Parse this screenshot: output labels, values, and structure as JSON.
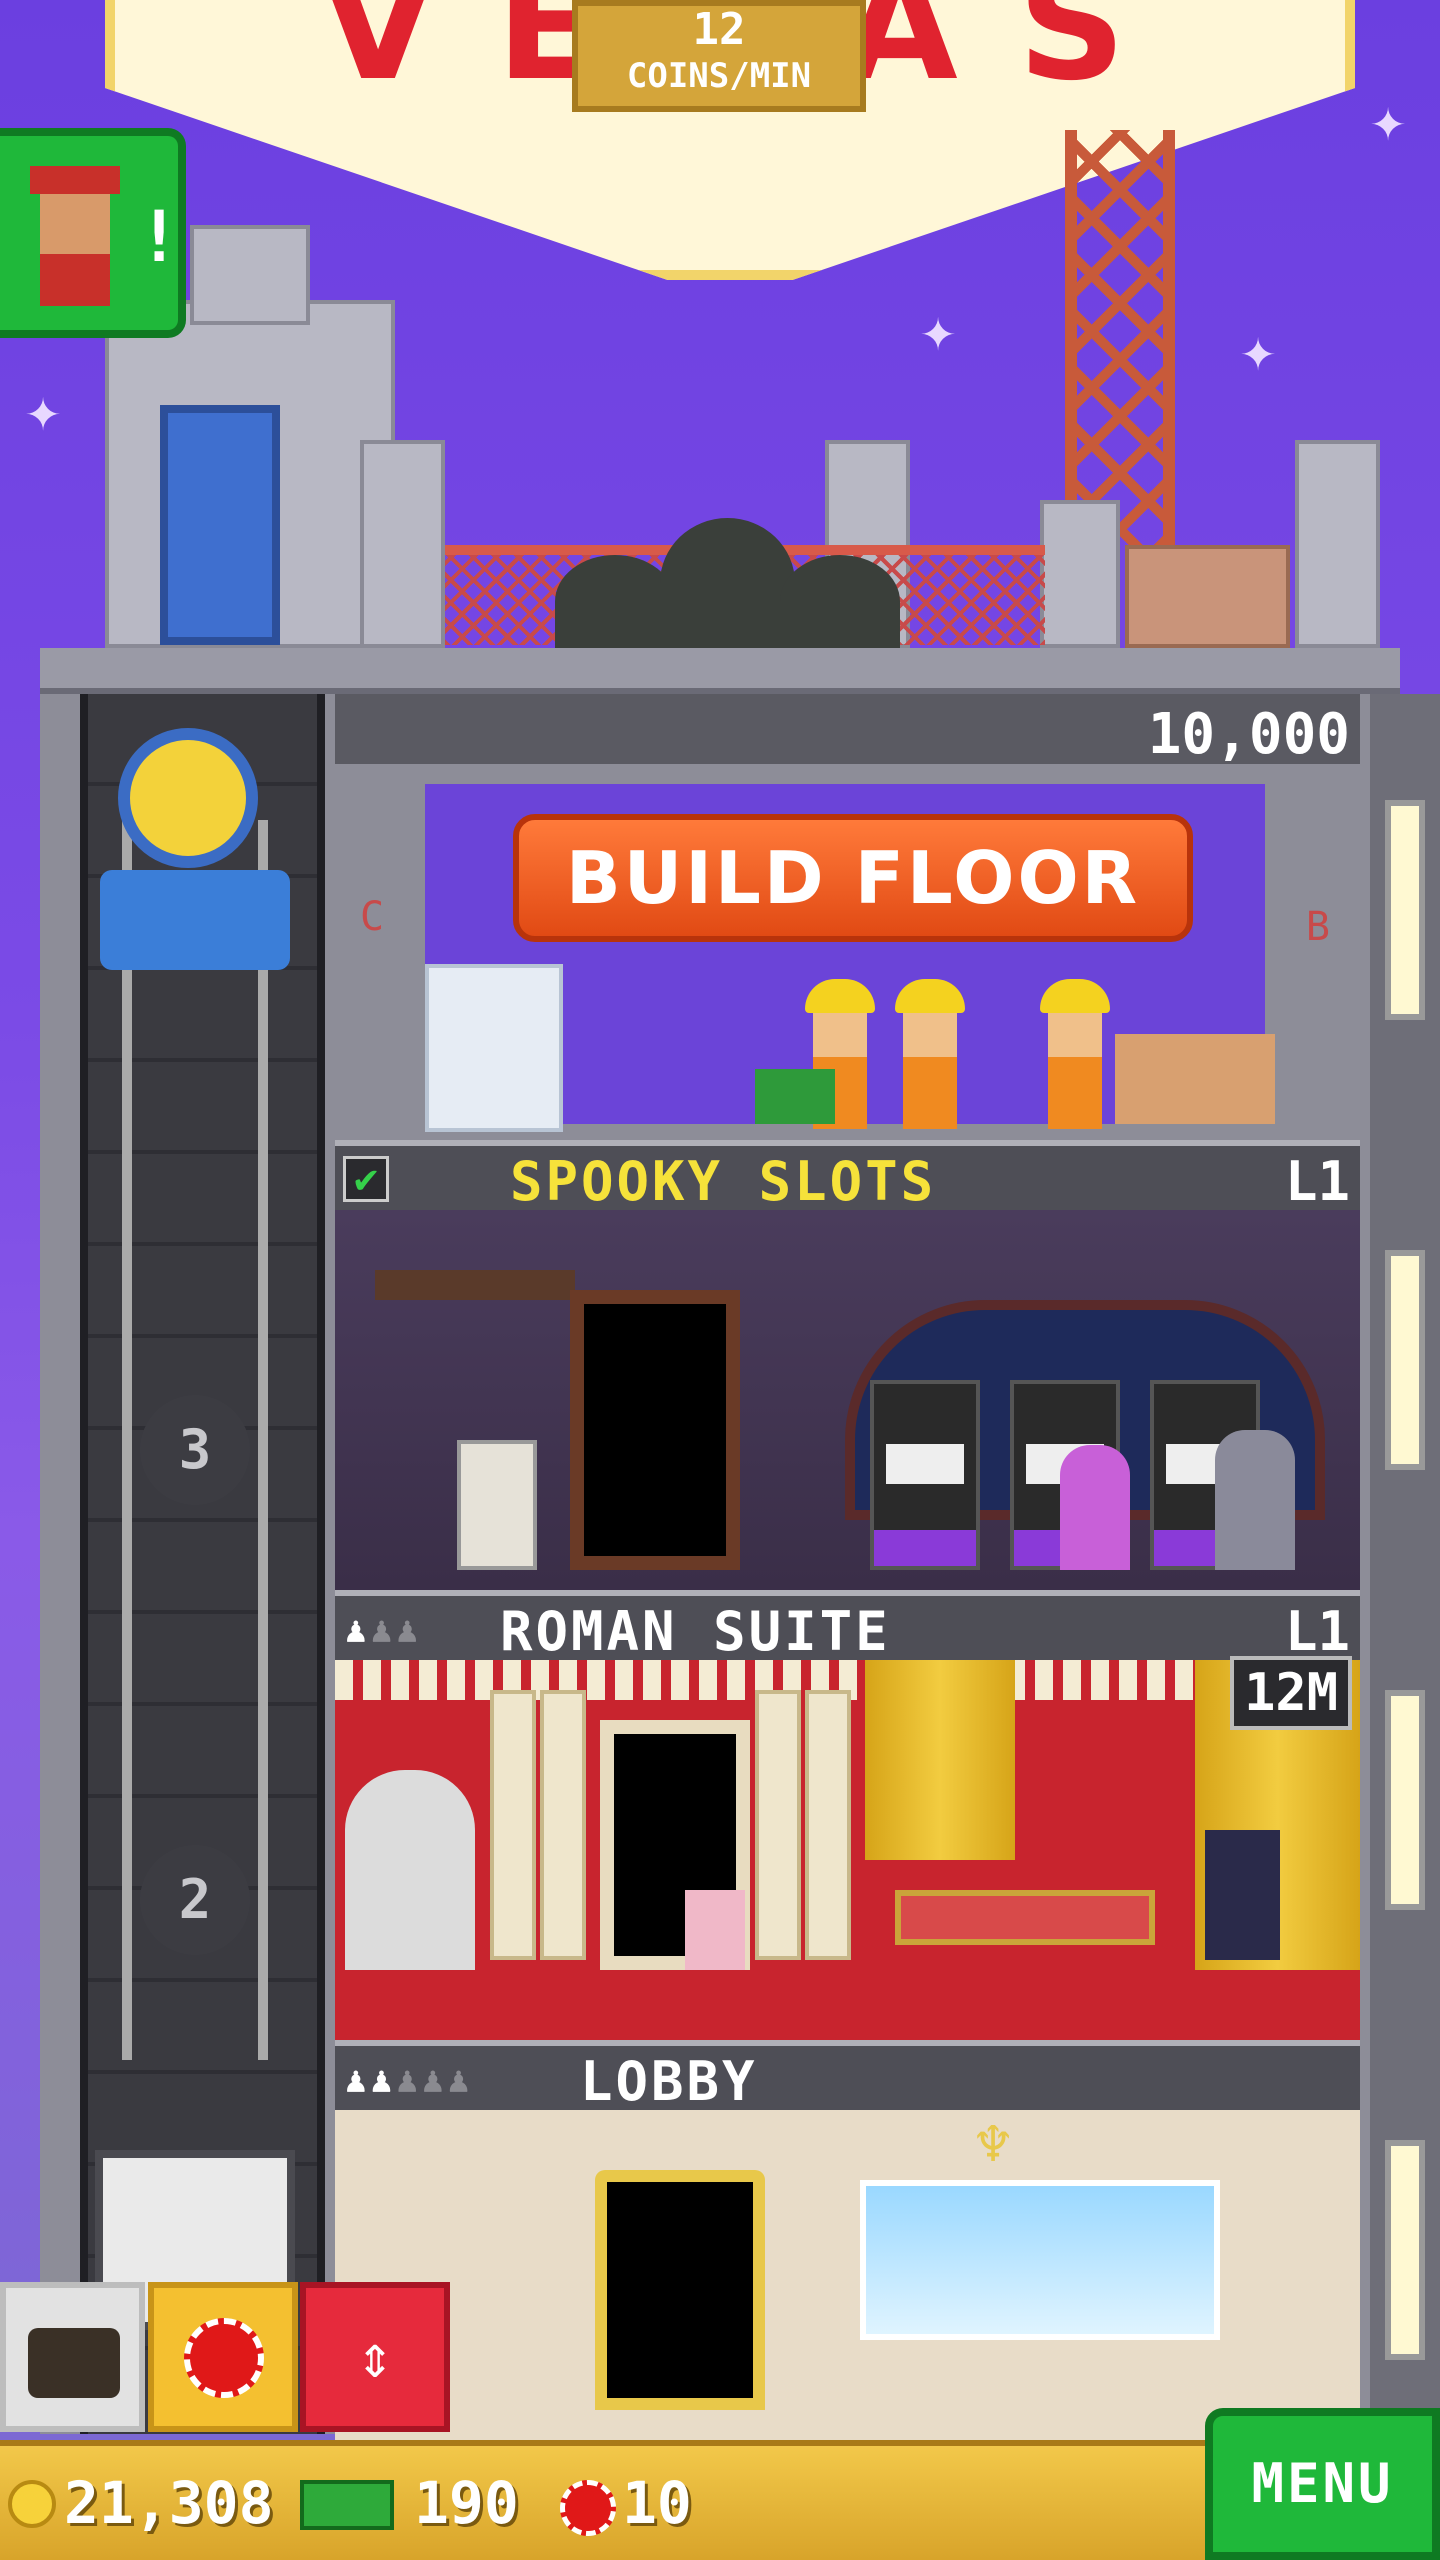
{
  "game": {
    "coin_rate": {
      "value": "12",
      "unit": "COINS/MIN"
    },
    "sign_letters": "VEGAS",
    "colors": {
      "sky": "#6b3fe0",
      "build_button": "#f05a20",
      "menu_button": "#1fb83a",
      "title_yellow": "#f6e23a"
    }
  },
  "hud": {
    "bellhop_alert": "!",
    "coins": "21,308",
    "bux": "190",
    "chips": "10",
    "menu_label": "MENU"
  },
  "toolbar": {
    "bag_icon": "briefcase-icon",
    "chip_icon": "casino-chip-icon",
    "elevator_icon": "up-down-arrows-icon",
    "elevator_glyph": "⇕"
  },
  "elevator": {
    "floor_labels": [
      "3",
      "2"
    ]
  },
  "floors": {
    "build": {
      "price": "10,000",
      "button_label": "BUILD FLOOR",
      "left_mark": "C",
      "right_mark": "B"
    },
    "spooky": {
      "check": "✔",
      "name": "SPOOKY SLOTS",
      "level": "L1"
    },
    "roman": {
      "name": "ROMAN SUITE",
      "level": "L1",
      "badge": "12M",
      "people_filled": "♟",
      "people_empty": "♟♟"
    },
    "lobby": {
      "name": "LOBBY",
      "people_filled": "♟♟",
      "people_empty": "♟♟♟"
    }
  }
}
